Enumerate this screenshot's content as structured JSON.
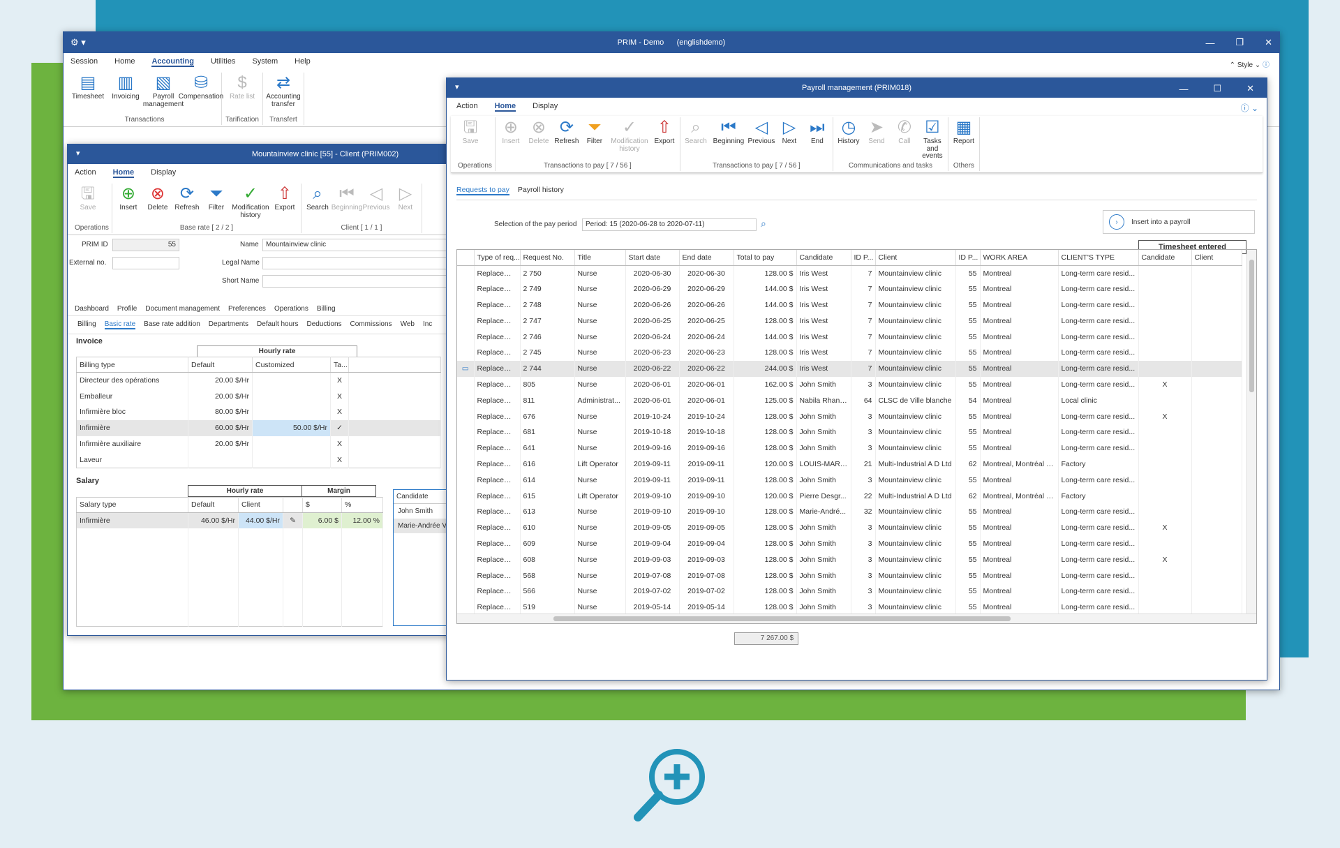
{
  "main": {
    "title": "PRIM - Demo      (englishdemo)",
    "menu": [
      "Session",
      "Home",
      "Accounting",
      "Utilities",
      "System",
      "Help"
    ],
    "style_label": "Style",
    "ribbon": [
      {
        "label": "Timesheet",
        "icon": "timesheet-icon"
      },
      {
        "label": "Invoicing",
        "icon": "invoicing-icon"
      },
      {
        "label": "Payroll management",
        "icon": "payroll-icon"
      },
      {
        "label": "Compensation",
        "icon": "compensation-icon"
      },
      {
        "label": "Rate list",
        "icon": "rate-list-icon"
      },
      {
        "label": "Accounting transfer",
        "icon": "accounting-transfer-icon"
      }
    ],
    "groups": [
      "Transactions",
      "Tarification",
      "Transfert"
    ]
  },
  "client": {
    "title": "Mountainview clinic [55] - Client (PRIM002)",
    "menu": [
      "Action",
      "Home",
      "Display"
    ],
    "ribbon": [
      "Save",
      "Insert",
      "Delete",
      "Refresh",
      "Filter",
      "Modification history",
      "Export",
      "Search",
      "Beginning",
      "Previous",
      "Next"
    ],
    "groups": [
      "Operations",
      "Base rate [ 2 / 2 ]",
      "Client [ 1 / 1 ]"
    ],
    "prim_id_label": "PRIM ID",
    "prim_id": "55",
    "name_label": "Name",
    "name": "Mountainview clinic",
    "external_label": "External no.",
    "legal_label": "Legal Name",
    "short_label": "Short Name",
    "nav": [
      "Dashboard",
      "Profile",
      "Document management",
      "Preferences",
      "Operations",
      "Billing"
    ],
    "tabs": [
      "Billing",
      "Basic rate",
      "Base rate addition",
      "Departments",
      "Default hours",
      "Deductions",
      "Commissions",
      "Web",
      "Inc"
    ],
    "invoice_label": "Invoice",
    "hourly_rate": "Hourly rate",
    "inv_headers": [
      "Billing type",
      "Default",
      "Customized",
      "Ta..."
    ],
    "inv_rows": [
      [
        "Directeur des opérations",
        "20.00 $/Hr",
        "",
        "X"
      ],
      [
        "Emballeur",
        "20.00 $/Hr",
        "",
        "X"
      ],
      [
        "Infirmière bloc",
        "80.00 $/Hr",
        "",
        "X"
      ],
      [
        "Infirmière",
        "60.00 $/Hr",
        "50.00 $/Hr",
        "✓"
      ],
      [
        "Infirmière auxiliaire",
        "20.00 $/Hr",
        "",
        "X"
      ],
      [
        "Laveur",
        "",
        "",
        "X"
      ]
    ],
    "salary_label": "Salary",
    "margin": "Margin",
    "sal_headers": [
      "Salary type",
      "Default",
      "Client",
      "$",
      "%"
    ],
    "sal_row": [
      "Infirmière",
      "46.00 $/Hr",
      "44.00 $/Hr",
      "6.00 $",
      "12.00 %"
    ],
    "cand_header": "Candidate",
    "cands": [
      "John Smith",
      "Marie-Andrée Ve"
    ]
  },
  "payroll": {
    "title": "Payroll management (PRIM018)",
    "menu": [
      "Action",
      "Home",
      "Display"
    ],
    "ribbon": [
      {
        "l": "Save",
        "d": 1
      },
      {
        "l": "Insert",
        "d": 1
      },
      {
        "l": "Delete",
        "d": 1
      },
      {
        "l": "Refresh",
        "d": 0
      },
      {
        "l": "Filter",
        "d": 0
      },
      {
        "l": "Modification history",
        "d": 1
      },
      {
        "l": "Export",
        "d": 0
      },
      {
        "l": "Search",
        "d": 1
      },
      {
        "l": "Beginning",
        "d": 0
      },
      {
        "l": "Previous",
        "d": 0
      },
      {
        "l": "Next",
        "d": 0
      },
      {
        "l": "End",
        "d": 0
      },
      {
        "l": "History",
        "d": 0
      },
      {
        "l": "Send",
        "d": 1
      },
      {
        "l": "Call",
        "d": 1
      },
      {
        "l": "Tasks and events",
        "d": 0
      },
      {
        "l": "Report",
        "d": 0
      }
    ],
    "groups": [
      "Operations",
      "Transactions to pay [ 7 / 56 ]",
      "Transactions to pay [ 7 / 56 ]",
      "Communications and tasks",
      "Others"
    ],
    "tabs": [
      "Requests to pay",
      "Payroll history"
    ],
    "period_label": "Selection of the pay period",
    "period_value": "Period: 15 (2020-06-28 to 2020-07-11)",
    "insert_btn": "Insert into a payroll",
    "ts_header": "Timesheet entered",
    "headers": [
      "Type of req...",
      "Request No.",
      "Title",
      "Start date",
      "End date",
      "Total to pay",
      "Candidate",
      "ID P...",
      "Client",
      "ID P...",
      "WORK AREA",
      "CLIENT'S TYPE",
      "Candidate",
      "Client"
    ],
    "rows": [
      [
        "Replacement",
        "2 750",
        "Nurse",
        "2020-06-30",
        "2020-06-30",
        "128.00 $",
        "Iris West",
        "7",
        "Mountainview clinic",
        "55",
        "Montreal",
        "Long-term care resid...",
        ""
      ],
      [
        "Replacement",
        "2 749",
        "Nurse",
        "2020-06-29",
        "2020-06-29",
        "144.00 $",
        "Iris West",
        "7",
        "Mountainview clinic",
        "55",
        "Montreal",
        "Long-term care resid...",
        ""
      ],
      [
        "Replacement",
        "2 748",
        "Nurse",
        "2020-06-26",
        "2020-06-26",
        "144.00 $",
        "Iris West",
        "7",
        "Mountainview clinic",
        "55",
        "Montreal",
        "Long-term care resid...",
        ""
      ],
      [
        "Replacement",
        "2 747",
        "Nurse",
        "2020-06-25",
        "2020-06-25",
        "128.00 $",
        "Iris West",
        "7",
        "Mountainview clinic",
        "55",
        "Montreal",
        "Long-term care resid...",
        ""
      ],
      [
        "Replacement",
        "2 746",
        "Nurse",
        "2020-06-24",
        "2020-06-24",
        "144.00 $",
        "Iris West",
        "7",
        "Mountainview clinic",
        "55",
        "Montreal",
        "Long-term care resid...",
        ""
      ],
      [
        "Replacement",
        "2 745",
        "Nurse",
        "2020-06-23",
        "2020-06-23",
        "128.00 $",
        "Iris West",
        "7",
        "Mountainview clinic",
        "55",
        "Montreal",
        "Long-term care resid...",
        ""
      ],
      [
        "Replacement",
        "2 744",
        "Nurse",
        "2020-06-22",
        "2020-06-22",
        "244.00 $",
        "Iris West",
        "7",
        "Mountainview clinic",
        "55",
        "Montreal",
        "Long-term care resid...",
        ""
      ],
      [
        "Replacement",
        "805",
        "Nurse",
        "2020-06-01",
        "2020-06-01",
        "162.00 $",
        "John Smith",
        "3",
        "Mountainview clinic",
        "55",
        "Montreal",
        "Long-term care resid...",
        "X"
      ],
      [
        "Replacement",
        "811",
        "Administrat...",
        "2020-06-01",
        "2020-06-01",
        "125.00 $",
        "Nabila Rhanem",
        "64",
        "CLSC de Ville blanche",
        "54",
        "Montreal",
        "Local clinic",
        ""
      ],
      [
        "Replacement",
        "676",
        "Nurse",
        "2019-10-24",
        "2019-10-24",
        "128.00 $",
        "John Smith",
        "3",
        "Mountainview clinic",
        "55",
        "Montreal",
        "Long-term care resid...",
        "X"
      ],
      [
        "Replacement",
        "681",
        "Nurse",
        "2019-10-18",
        "2019-10-18",
        "128.00 $",
        "John Smith",
        "3",
        "Mountainview clinic",
        "55",
        "Montreal",
        "Long-term care resid...",
        ""
      ],
      [
        "Replacement",
        "641",
        "Nurse",
        "2019-09-16",
        "2019-09-16",
        "128.00 $",
        "John Smith",
        "3",
        "Mountainview clinic",
        "55",
        "Montreal",
        "Long-term care resid...",
        ""
      ],
      [
        "Replacement",
        "616",
        "Lift Operator",
        "2019-09-11",
        "2019-09-11",
        "120.00 $",
        "LOUIS-MART...",
        "21",
        "Multi-Industrial A D Ltd",
        "62",
        "Montreal, Montréal N...",
        "Factory",
        ""
      ],
      [
        "Replacement",
        "614",
        "Nurse",
        "2019-09-11",
        "2019-09-11",
        "128.00 $",
        "John Smith",
        "3",
        "Mountainview clinic",
        "55",
        "Montreal",
        "Long-term care resid...",
        ""
      ],
      [
        "Replacement",
        "615",
        "Lift Operator",
        "2019-09-10",
        "2019-09-10",
        "120.00 $",
        "Pierre Desgr...",
        "22",
        "Multi-Industrial A D Ltd",
        "62",
        "Montreal, Montréal N...",
        "Factory",
        ""
      ],
      [
        "Replacement",
        "613",
        "Nurse",
        "2019-09-10",
        "2019-09-10",
        "128.00 $",
        "Marie-André...",
        "32",
        "Mountainview clinic",
        "55",
        "Montreal",
        "Long-term care resid...",
        ""
      ],
      [
        "Replacement",
        "610",
        "Nurse",
        "2019-09-05",
        "2019-09-05",
        "128.00 $",
        "John Smith",
        "3",
        "Mountainview clinic",
        "55",
        "Montreal",
        "Long-term care resid...",
        "X"
      ],
      [
        "Replacement",
        "609",
        "Nurse",
        "2019-09-04",
        "2019-09-04",
        "128.00 $",
        "John Smith",
        "3",
        "Mountainview clinic",
        "55",
        "Montreal",
        "Long-term care resid...",
        ""
      ],
      [
        "Replacement",
        "608",
        "Nurse",
        "2019-09-03",
        "2019-09-03",
        "128.00 $",
        "John Smith",
        "3",
        "Mountainview clinic",
        "55",
        "Montreal",
        "Long-term care resid...",
        "X"
      ],
      [
        "Replacement",
        "568",
        "Nurse",
        "2019-07-08",
        "2019-07-08",
        "128.00 $",
        "John Smith",
        "3",
        "Mountainview clinic",
        "55",
        "Montreal",
        "Long-term care resid...",
        ""
      ],
      [
        "Replacement",
        "566",
        "Nurse",
        "2019-07-02",
        "2019-07-02",
        "128.00 $",
        "John Smith",
        "3",
        "Mountainview clinic",
        "55",
        "Montreal",
        "Long-term care resid...",
        ""
      ],
      [
        "Replacement",
        "519",
        "Nurse",
        "2019-05-14",
        "2019-05-14",
        "128.00 $",
        "John Smith",
        "3",
        "Mountainview clinic",
        "55",
        "Montreal",
        "Long-term care resid...",
        ""
      ]
    ],
    "total": "7 267.00 $"
  }
}
